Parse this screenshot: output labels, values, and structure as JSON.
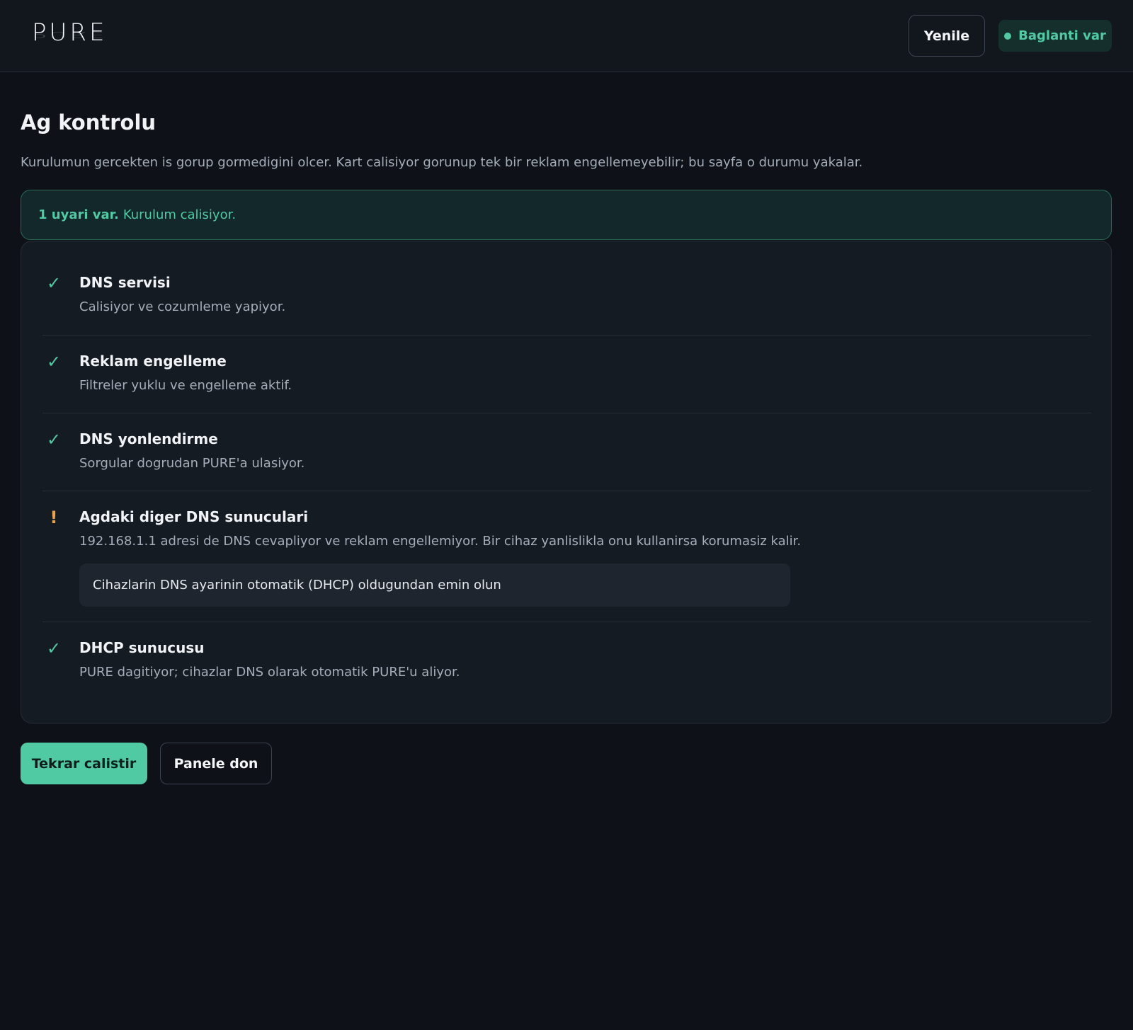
{
  "header": {
    "logo": "PURE",
    "refresh_label": "Yenile",
    "status_label": "Baglanti var"
  },
  "page": {
    "title": "Ag kontrolu",
    "description": "Kurulumun gercekten is gorup gormedigini olcer. Kart calisiyor gorunup tek bir reklam engellemeyebilir; bu sayfa o durumu yakalar."
  },
  "alert": {
    "strong": "1 uyari var.",
    "text": "Kurulum calisiyor."
  },
  "checks": [
    {
      "status": "ok",
      "icon": "✓",
      "title": "DNS servisi",
      "description": "Calisiyor ve cozumleme yapiyor."
    },
    {
      "status": "ok",
      "icon": "✓",
      "title": "Reklam engelleme",
      "description": "Filtreler yuklu ve engelleme aktif."
    },
    {
      "status": "ok",
      "icon": "✓",
      "title": "DNS yonlendirme",
      "description": "Sorgular dogrudan PURE'a ulasiyor."
    },
    {
      "status": "warn",
      "icon": "!",
      "title": "Agdaki diger DNS sunuculari",
      "description": "192.168.1.1 adresi de DNS cevapliyor ve reklam engellemiyor. Bir cihaz yanlislikla onu kullanirsa korumasiz kalir.",
      "hint": "Cihazlarin DNS ayarinin otomatik (DHCP) oldugundan emin olun"
    },
    {
      "status": "ok",
      "icon": "✓",
      "title": "DHCP sunucusu",
      "description": "PURE dagitiyor; cihazlar DNS olarak otomatik PURE'u aliyor."
    }
  ],
  "actions": {
    "rerun_label": "Tekrar calistir",
    "back_label": "Panele don"
  },
  "colors": {
    "accent": "#4fcaa3",
    "warning": "#e8a54b",
    "background": "#0e1218"
  }
}
